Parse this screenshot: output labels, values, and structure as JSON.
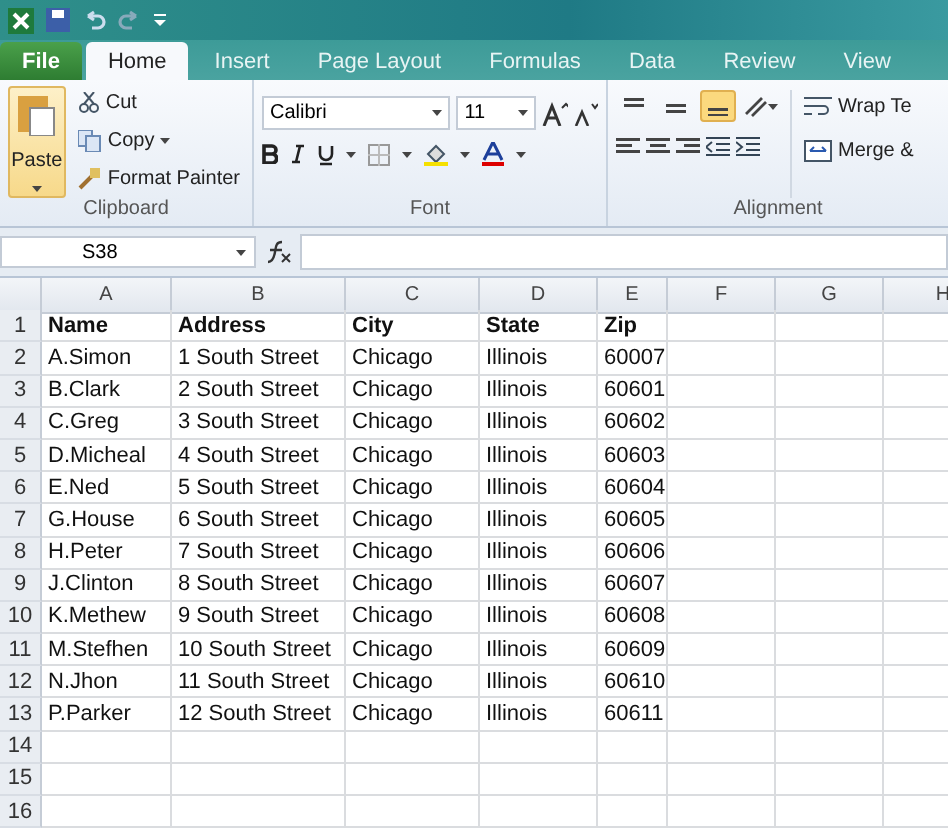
{
  "tabs": [
    {
      "label": "File",
      "kind": "file",
      "selected": false
    },
    {
      "label": "Home",
      "kind": "tab",
      "selected": true
    },
    {
      "label": "Insert",
      "kind": "tab",
      "selected": false
    },
    {
      "label": "Page Layout",
      "kind": "tab",
      "selected": false
    },
    {
      "label": "Formulas",
      "kind": "tab",
      "selected": false
    },
    {
      "label": "Data",
      "kind": "tab",
      "selected": false
    },
    {
      "label": "Review",
      "kind": "tab",
      "selected": false
    },
    {
      "label": "View",
      "kind": "tab",
      "selected": false
    }
  ],
  "clipboard": {
    "label": "Clipboard",
    "paste": "Paste",
    "cut": "Cut",
    "copy": "Copy",
    "format_painter": "Format Painter"
  },
  "font": {
    "label": "Font",
    "font_name": "Calibri",
    "font_size": "11"
  },
  "alignment": {
    "label": "Alignment",
    "vertical": [
      {
        "kind": "top",
        "selected": false
      },
      {
        "kind": "middle",
        "selected": false
      },
      {
        "kind": "bottom",
        "selected": true
      }
    ],
    "wrap": "Wrap Te",
    "merge": "Merge &"
  },
  "name_box": "S38",
  "columns": [
    "A",
    "B",
    "C",
    "D",
    "E",
    "F",
    "G",
    "H"
  ],
  "rows": [
    {
      "number": "1",
      "kind": "header",
      "cells": [
        "Name",
        "Address",
        "City",
        "State",
        "Zip"
      ]
    },
    {
      "number": "2",
      "kind": "data",
      "cells": [
        "A.Simon",
        "1 South Street",
        "Chicago",
        "Illinois",
        "60007"
      ]
    },
    {
      "number": "3",
      "kind": "data",
      "cells": [
        "B.Clark",
        "2 South Street",
        "Chicago",
        "Illinois",
        "60601"
      ]
    },
    {
      "number": "4",
      "kind": "data",
      "cells": [
        "C.Greg",
        "3 South Street",
        "Chicago",
        "Illinois",
        "60602"
      ]
    },
    {
      "number": "5",
      "kind": "data",
      "cells": [
        "D.Micheal",
        "4 South Street",
        "Chicago",
        "Illinois",
        "60603"
      ]
    },
    {
      "number": "6",
      "kind": "data",
      "cells": [
        "E.Ned",
        "5 South Street",
        "Chicago",
        "Illinois",
        "60604"
      ]
    },
    {
      "number": "7",
      "kind": "data",
      "cells": [
        "G.House",
        "6 South Street",
        "Chicago",
        "Illinois",
        "60605"
      ]
    },
    {
      "number": "8",
      "kind": "data",
      "cells": [
        "H.Peter",
        "7 South Street",
        "Chicago",
        "Illinois",
        "60606"
      ]
    },
    {
      "number": "9",
      "kind": "data",
      "cells": [
        "J.Clinton",
        "8 South Street",
        "Chicago",
        "Illinois",
        "60607"
      ]
    },
    {
      "number": "10",
      "kind": "data",
      "cells": [
        "K.Methew",
        "9 South Street",
        "Chicago",
        "Illinois",
        "60608"
      ]
    },
    {
      "number": "11",
      "kind": "data",
      "cells": [
        "M.Stefhen",
        "10 South Street",
        "Chicago",
        "Illinois",
        "60609"
      ]
    },
    {
      "number": "12",
      "kind": "data",
      "cells": [
        "N.Jhon",
        "11 South Street",
        "Chicago",
        "Illinois",
        "60610"
      ]
    },
    {
      "number": "13",
      "kind": "data",
      "cells": [
        "P.Parker",
        "12 South Street",
        "Chicago",
        "Illinois",
        "60611"
      ]
    },
    {
      "number": "14",
      "cells": []
    },
    {
      "number": "15",
      "cells": []
    },
    {
      "number": "16",
      "cells": []
    }
  ]
}
